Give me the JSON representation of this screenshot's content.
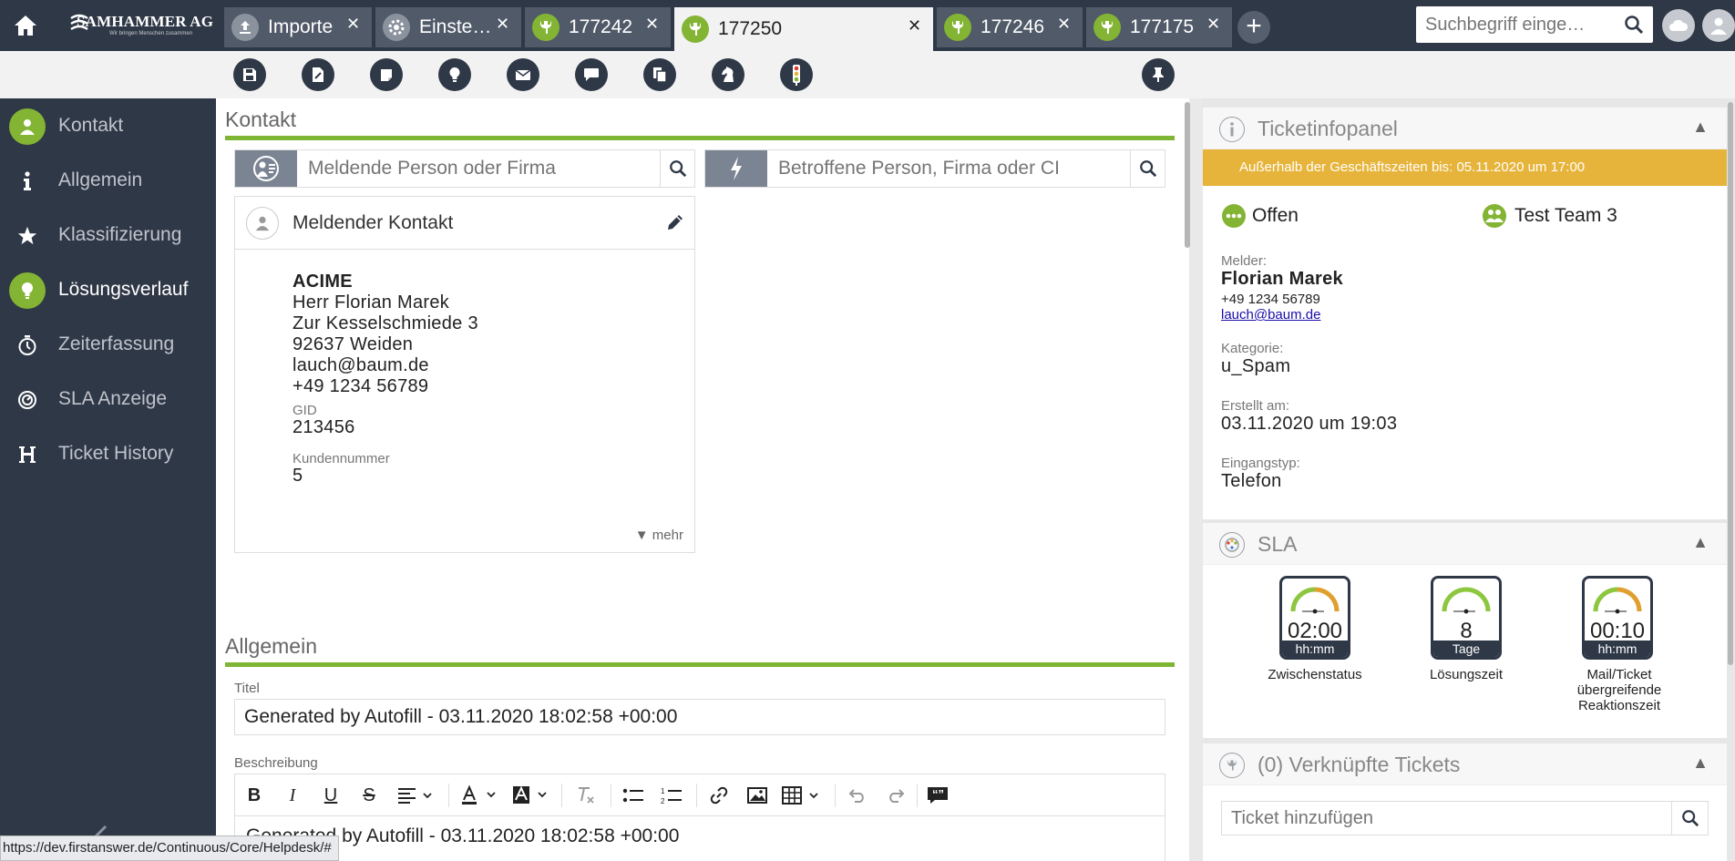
{
  "colors": {
    "accent_green": "#83b434",
    "dark_navy": "#2f3847",
    "warning": "#e7b43b",
    "gauge_green": "#8dc63f",
    "gauge_orange": "#e0a030"
  },
  "brand": {
    "name": "SAMHAMMER AG",
    "tagline": "Wir bringen Menschen zusammen"
  },
  "tabs": [
    {
      "label": "Importe",
      "icon": "upload-icon",
      "active": false
    },
    {
      "label": "Einste…",
      "icon": "settings-icon",
      "active": false
    },
    {
      "label": "177242",
      "icon": "wrench-icon",
      "active": false
    },
    {
      "label": "177250",
      "icon": "wrench-icon",
      "active": true
    },
    {
      "label": "177246",
      "icon": "wrench-icon",
      "active": false
    },
    {
      "label": "177175",
      "icon": "wrench-icon",
      "active": false
    }
  ],
  "tab_close": "✕",
  "search": {
    "placeholder": "Suchbegriff einge…"
  },
  "toolbar": {
    "icons": [
      "save-icon",
      "edit-document-icon",
      "note-icon",
      "lightbulb-icon",
      "mail-icon",
      "chat-icon",
      "copy-icon",
      "chess-knight-icon",
      "traffic-light-icon"
    ],
    "pin_icon": "pin-icon"
  },
  "sidebar": {
    "items": [
      {
        "label": "Kontakt",
        "icon": "person-icon",
        "active": false
      },
      {
        "label": "Allgemein",
        "icon": "info-icon",
        "active": false
      },
      {
        "label": "Klassifizierung",
        "icon": "star-icon",
        "active": false
      },
      {
        "label": "Lösungsverlauf",
        "icon": "lightbulb-icon",
        "active": true
      },
      {
        "label": "Zeiterfassung",
        "icon": "stopwatch-icon",
        "active": false
      },
      {
        "label": "SLA Anzeige",
        "icon": "gauge-icon",
        "active": false
      },
      {
        "label": "Ticket History",
        "icon": "history-icon",
        "active": false
      }
    ]
  },
  "kontakt": {
    "title": "Kontakt",
    "reporter_placeholder": "Meldende Person oder Firma",
    "affected_placeholder": "Betroffene Person, Firma oder CI",
    "card": {
      "title": "Meldender Kontakt",
      "company": "ACIME",
      "name": "Herr Florian Marek",
      "street": "Zur Kesselschmiede 3",
      "city": "92637 Weiden",
      "email": "lauch@baum.de",
      "phone": "+49 1234 56789",
      "gid_label": "GID",
      "gid": "213456",
      "customer_no_label": "Kundennummer",
      "customer_no": "5",
      "more": "▼ mehr"
    }
  },
  "allgemein": {
    "title": "Allgemein",
    "titel_label": "Titel",
    "titel_value": "Generated by Autofill - 03.11.2020 18:02:58 +00:00",
    "beschreibung_label": "Beschreibung",
    "beschreibung_value": "Generated by Autofill - 03.11.2020 18:02:58 +00:00"
  },
  "ticketinfo": {
    "title": "Ticketinfopanel",
    "collapse": "▲",
    "banner": "Außerhalb der Geschäftszeiten bis: 05.11.2020 um 17:00",
    "status": "Offen",
    "team": "Test Team 3",
    "melder_label": "Melder:",
    "melder_name": "Florian Marek",
    "melder_phone": "+49 1234 56789",
    "melder_email": "lauch@baum.de",
    "kategorie_label": "Kategorie:",
    "kategorie": "u_Spam",
    "erstellt_label": "Erstellt am:",
    "erstellt": "03.11.2020 um 19:03",
    "eingangstyp_label": "Eingangstyp:",
    "eingangstyp": "Telefon"
  },
  "sla": {
    "title": "SLA",
    "collapse": "▲",
    "gauges": [
      {
        "value": "02:00",
        "unit": "hh:mm",
        "label": "Zwischenstatus"
      },
      {
        "value": "8",
        "unit": "Tage",
        "label": "Lösungszeit"
      },
      {
        "value": "00:10",
        "unit": "hh:mm",
        "label": "Mail/Ticket übergreifende Reaktionszeit"
      }
    ]
  },
  "linked": {
    "title": "(0) Verknüpfte Tickets",
    "collapse": "▲",
    "placeholder": "Ticket hinzufügen"
  },
  "statusbar": {
    "url": "https://dev.firstanswer.de/Continuous/Core/Helpdesk/#"
  }
}
